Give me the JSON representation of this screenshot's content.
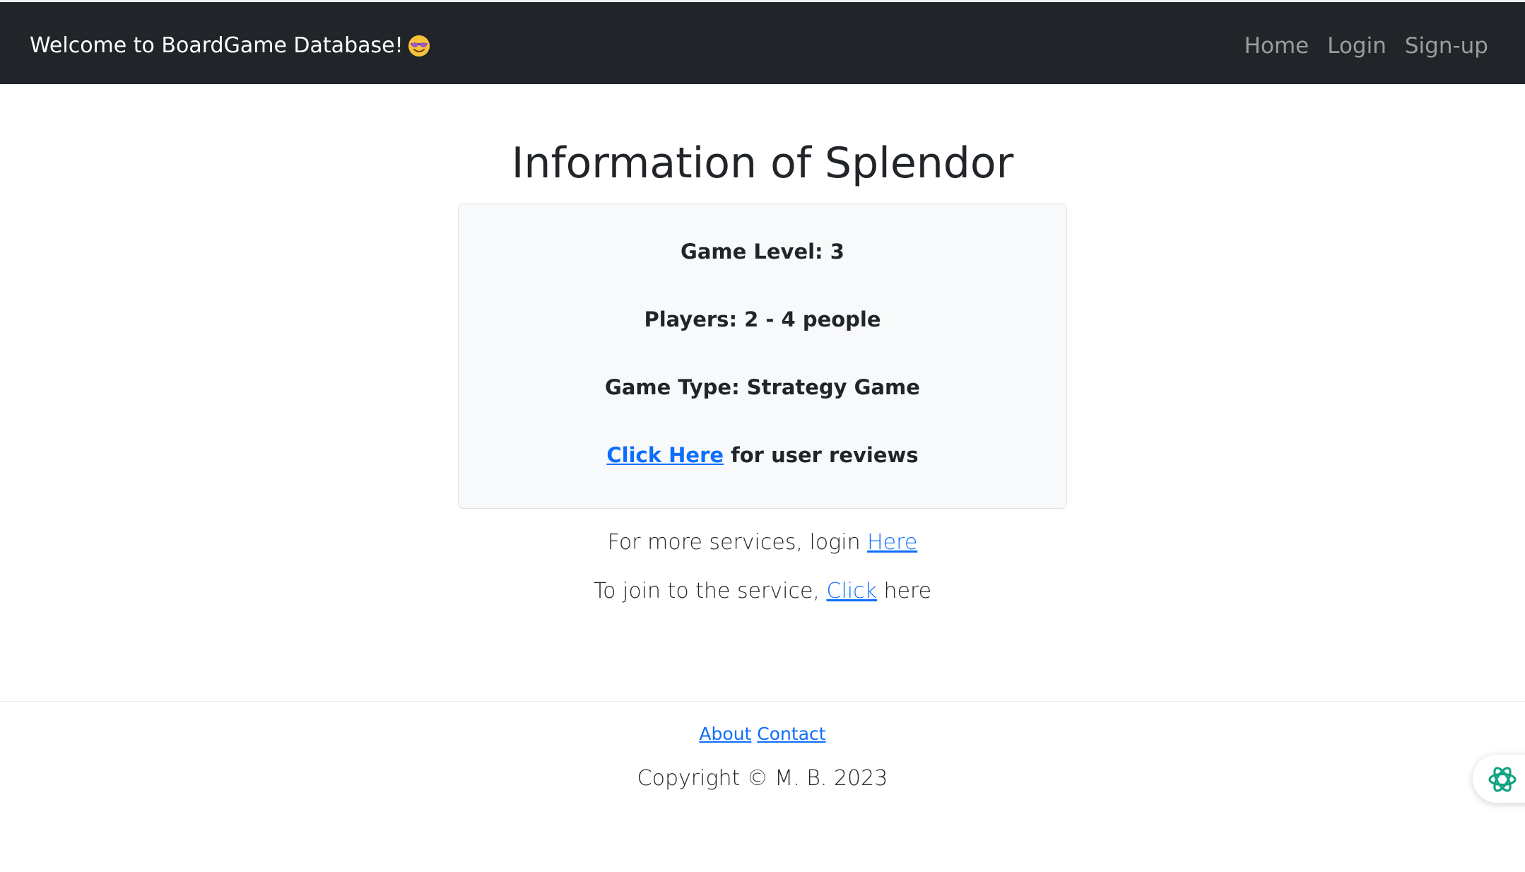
{
  "navbar": {
    "brand": "Welcome to BoardGame Database!",
    "brand_emoji_icon": "smiling-face-with-sunglasses-icon",
    "links": {
      "home": "Home",
      "login": "Login",
      "signup": "Sign-up"
    }
  },
  "main": {
    "title": "Information of Splendor",
    "card": {
      "level": "Game Level: 3",
      "players": "Players: 2 - 4 people",
      "type": "Game Type: Strategy Game",
      "reviews_link": "Click Here",
      "reviews_suffix": " for user reviews"
    },
    "login_prompt": {
      "prefix": "For more services, login ",
      "link": "Here"
    },
    "join_prompt": {
      "prefix": "To join to the service, ",
      "link": "Click",
      "suffix": " here"
    }
  },
  "footer": {
    "about": "About",
    "contact": "Contact",
    "copyright": "Copyright © M. B. 2023"
  },
  "colors": {
    "navbar_bg": "#212529",
    "link": "#0d6efd",
    "card_bg": "#f8f9fa",
    "assistant_icon": "#10a37f"
  },
  "widgets": {
    "assistant_icon": "chatgpt-logo-icon"
  }
}
